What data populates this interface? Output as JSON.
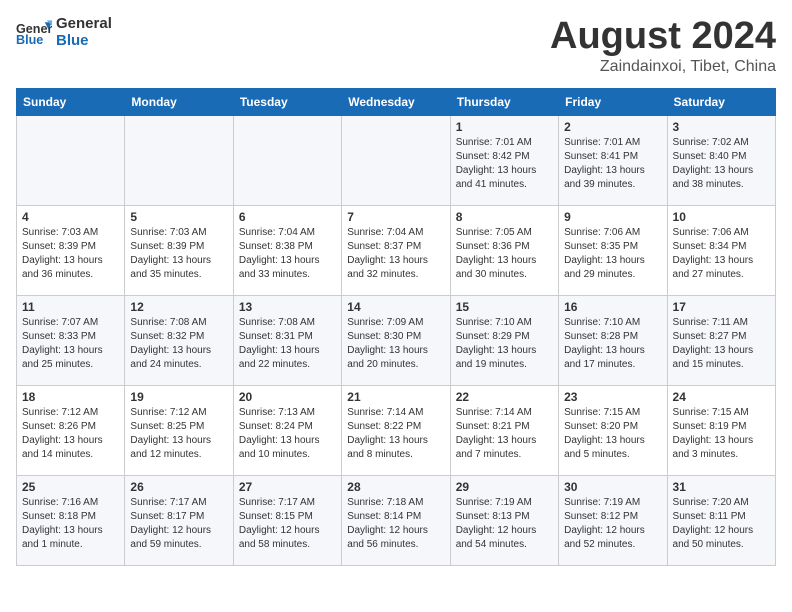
{
  "logo": {
    "line1": "General",
    "line2": "Blue"
  },
  "title": "August 2024",
  "subtitle": "Zaindainxoi, Tibet, China",
  "weekdays": [
    "Sunday",
    "Monday",
    "Tuesday",
    "Wednesday",
    "Thursday",
    "Friday",
    "Saturday"
  ],
  "weeks": [
    [
      {
        "day": "",
        "info": ""
      },
      {
        "day": "",
        "info": ""
      },
      {
        "day": "",
        "info": ""
      },
      {
        "day": "",
        "info": ""
      },
      {
        "day": "1",
        "info": "Sunrise: 7:01 AM\nSunset: 8:42 PM\nDaylight: 13 hours\nand 41 minutes."
      },
      {
        "day": "2",
        "info": "Sunrise: 7:01 AM\nSunset: 8:41 PM\nDaylight: 13 hours\nand 39 minutes."
      },
      {
        "day": "3",
        "info": "Sunrise: 7:02 AM\nSunset: 8:40 PM\nDaylight: 13 hours\nand 38 minutes."
      }
    ],
    [
      {
        "day": "4",
        "info": "Sunrise: 7:03 AM\nSunset: 8:39 PM\nDaylight: 13 hours\nand 36 minutes."
      },
      {
        "day": "5",
        "info": "Sunrise: 7:03 AM\nSunset: 8:39 PM\nDaylight: 13 hours\nand 35 minutes."
      },
      {
        "day": "6",
        "info": "Sunrise: 7:04 AM\nSunset: 8:38 PM\nDaylight: 13 hours\nand 33 minutes."
      },
      {
        "day": "7",
        "info": "Sunrise: 7:04 AM\nSunset: 8:37 PM\nDaylight: 13 hours\nand 32 minutes."
      },
      {
        "day": "8",
        "info": "Sunrise: 7:05 AM\nSunset: 8:36 PM\nDaylight: 13 hours\nand 30 minutes."
      },
      {
        "day": "9",
        "info": "Sunrise: 7:06 AM\nSunset: 8:35 PM\nDaylight: 13 hours\nand 29 minutes."
      },
      {
        "day": "10",
        "info": "Sunrise: 7:06 AM\nSunset: 8:34 PM\nDaylight: 13 hours\nand 27 minutes."
      }
    ],
    [
      {
        "day": "11",
        "info": "Sunrise: 7:07 AM\nSunset: 8:33 PM\nDaylight: 13 hours\nand 25 minutes."
      },
      {
        "day": "12",
        "info": "Sunrise: 7:08 AM\nSunset: 8:32 PM\nDaylight: 13 hours\nand 24 minutes."
      },
      {
        "day": "13",
        "info": "Sunrise: 7:08 AM\nSunset: 8:31 PM\nDaylight: 13 hours\nand 22 minutes."
      },
      {
        "day": "14",
        "info": "Sunrise: 7:09 AM\nSunset: 8:30 PM\nDaylight: 13 hours\nand 20 minutes."
      },
      {
        "day": "15",
        "info": "Sunrise: 7:10 AM\nSunset: 8:29 PM\nDaylight: 13 hours\nand 19 minutes."
      },
      {
        "day": "16",
        "info": "Sunrise: 7:10 AM\nSunset: 8:28 PM\nDaylight: 13 hours\nand 17 minutes."
      },
      {
        "day": "17",
        "info": "Sunrise: 7:11 AM\nSunset: 8:27 PM\nDaylight: 13 hours\nand 15 minutes."
      }
    ],
    [
      {
        "day": "18",
        "info": "Sunrise: 7:12 AM\nSunset: 8:26 PM\nDaylight: 13 hours\nand 14 minutes."
      },
      {
        "day": "19",
        "info": "Sunrise: 7:12 AM\nSunset: 8:25 PM\nDaylight: 13 hours\nand 12 minutes."
      },
      {
        "day": "20",
        "info": "Sunrise: 7:13 AM\nSunset: 8:24 PM\nDaylight: 13 hours\nand 10 minutes."
      },
      {
        "day": "21",
        "info": "Sunrise: 7:14 AM\nSunset: 8:22 PM\nDaylight: 13 hours\nand 8 minutes."
      },
      {
        "day": "22",
        "info": "Sunrise: 7:14 AM\nSunset: 8:21 PM\nDaylight: 13 hours\nand 7 minutes."
      },
      {
        "day": "23",
        "info": "Sunrise: 7:15 AM\nSunset: 8:20 PM\nDaylight: 13 hours\nand 5 minutes."
      },
      {
        "day": "24",
        "info": "Sunrise: 7:15 AM\nSunset: 8:19 PM\nDaylight: 13 hours\nand 3 minutes."
      }
    ],
    [
      {
        "day": "25",
        "info": "Sunrise: 7:16 AM\nSunset: 8:18 PM\nDaylight: 13 hours\nand 1 minute."
      },
      {
        "day": "26",
        "info": "Sunrise: 7:17 AM\nSunset: 8:17 PM\nDaylight: 12 hours\nand 59 minutes."
      },
      {
        "day": "27",
        "info": "Sunrise: 7:17 AM\nSunset: 8:15 PM\nDaylight: 12 hours\nand 58 minutes."
      },
      {
        "day": "28",
        "info": "Sunrise: 7:18 AM\nSunset: 8:14 PM\nDaylight: 12 hours\nand 56 minutes."
      },
      {
        "day": "29",
        "info": "Sunrise: 7:19 AM\nSunset: 8:13 PM\nDaylight: 12 hours\nand 54 minutes."
      },
      {
        "day": "30",
        "info": "Sunrise: 7:19 AM\nSunset: 8:12 PM\nDaylight: 12 hours\nand 52 minutes."
      },
      {
        "day": "31",
        "info": "Sunrise: 7:20 AM\nSunset: 8:11 PM\nDaylight: 12 hours\nand 50 minutes."
      }
    ]
  ]
}
